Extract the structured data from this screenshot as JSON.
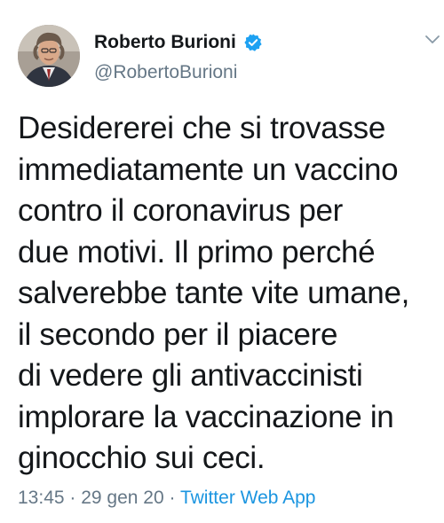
{
  "tweet": {
    "author": {
      "display_name": "Roberto Burioni",
      "handle": "@RobertoBurioni",
      "verified": true
    },
    "icons": {
      "verified": "verified-badge-icon",
      "menu": "chevron-down-icon",
      "avatar": "profile-photo"
    },
    "text_lines": [
      "Desidererei che si trovasse",
      "immediatamente un vaccino",
      "contro il coronavirus per",
      "due motivi. Il primo perché",
      "salverebbe tante vite umane,",
      "il secondo per il piacere",
      "di vedere gli antivaccinisti",
      "implorare la vaccinazione in",
      "ginocchio sui ceci."
    ],
    "meta": {
      "time": "13:45",
      "separator": " · ",
      "date": "29 gen 20",
      "source": "Twitter Web App"
    },
    "colors": {
      "text": "#14171a",
      "secondary": "#657786",
      "accent": "#1b95e0",
      "verified": "#1da1f2"
    }
  }
}
